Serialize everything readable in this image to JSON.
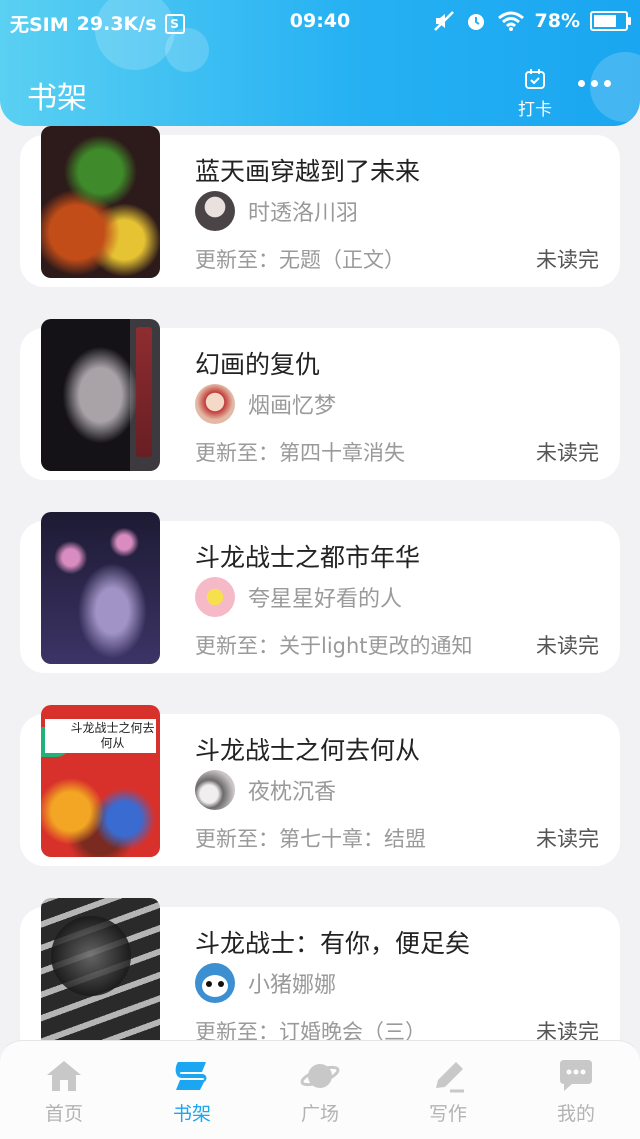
{
  "status_bar": {
    "carrier": "无SIM",
    "speed": "29.3K/s",
    "s_icon_text": "S",
    "time": "09:40",
    "battery": "78%",
    "battery_level": 0.78
  },
  "header": {
    "title": "书架",
    "checkin_label": "打卡",
    "accent_color": "#1aa6f0"
  },
  "books": [
    {
      "title": "蓝天画穿越到了未来",
      "author": "时透洛川羽",
      "update": "更新至：无题（正文）",
      "status": "未读完",
      "cover_colors": [
        "#2d1a1a",
        "#c24d19",
        "#3f8a2a",
        "#e6c333"
      ]
    },
    {
      "title": "幻画的复仇",
      "author": "烟画忆梦",
      "update": "更新至：第四十章消失",
      "status": "未读完",
      "cover_colors": [
        "#3c3a3f",
        "#a9a3a8",
        "#141216",
        "#9e2a2e"
      ]
    },
    {
      "title": "斗龙战士之都市年华",
      "author": "夸星星好看的人",
      "update": "更新至：关于light更改的通知",
      "status": "未读完",
      "cover_colors": [
        "#1d1a33",
        "#3c3466",
        "#a193c6",
        "#d98cbf"
      ]
    },
    {
      "title": "斗龙战士之何去何从",
      "author": "夜枕沉香",
      "update": "更新至：第七十章：结盟",
      "status": "未读完",
      "cover_text": "斗龙战士之何去何从",
      "cover_colors": [
        "#d8312b",
        "#f2a623",
        "#3a6bd1",
        "#7a2a1f"
      ]
    },
    {
      "title": "斗龙战士：有你，便足矣",
      "author": "小猪娜娜",
      "update": "更新至：订婚晚会（三）",
      "status": "未读完",
      "cover_colors": [
        "#2a2a2a",
        "#6d6d6d",
        "#b5b5b5",
        "#1a1a1a"
      ]
    }
  ],
  "nav": [
    {
      "label": "首页",
      "icon": "home-icon",
      "active": false
    },
    {
      "label": "书架",
      "icon": "bookshelf-icon",
      "active": true
    },
    {
      "label": "广场",
      "icon": "planet-icon",
      "active": false
    },
    {
      "label": "写作",
      "icon": "pen-icon",
      "active": false
    },
    {
      "label": "我的",
      "icon": "chat-bubble-icon",
      "active": false
    }
  ]
}
